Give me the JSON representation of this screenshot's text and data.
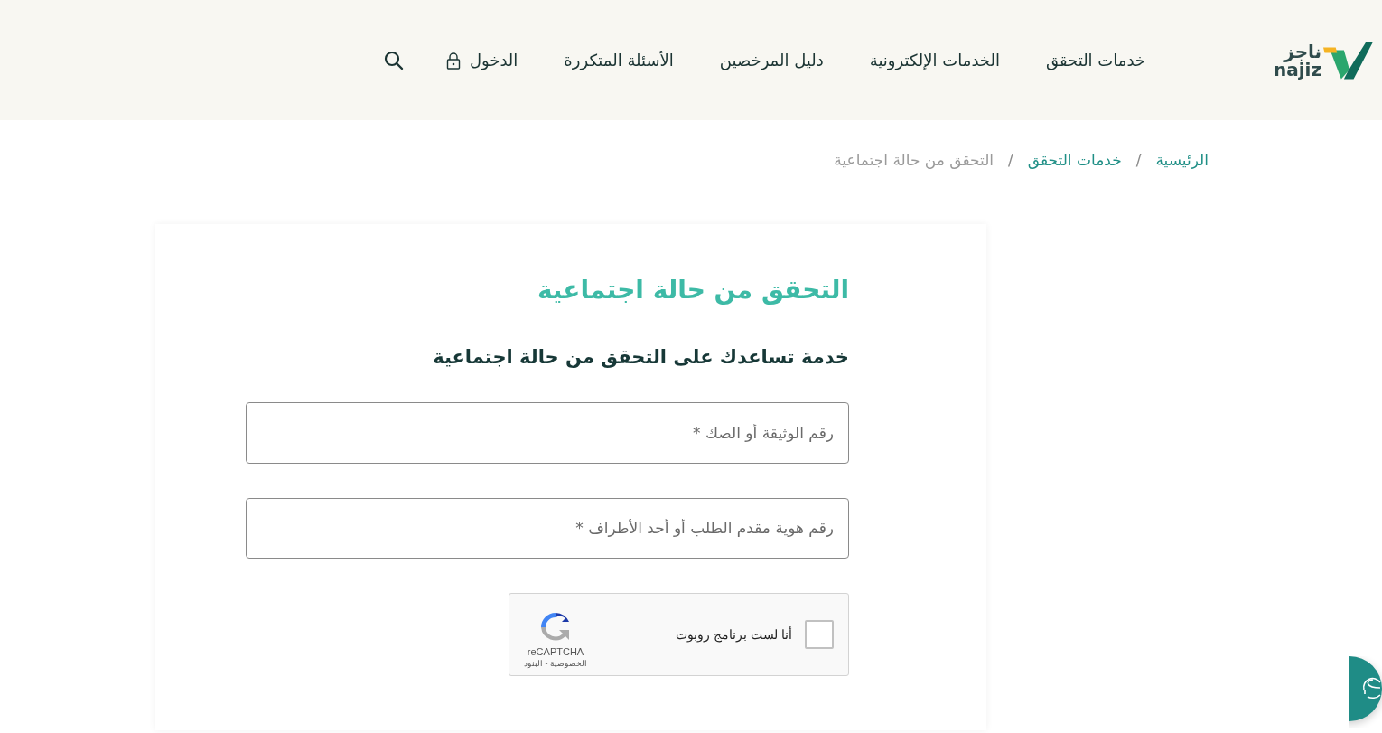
{
  "header": {
    "logo": {
      "arabic": "ناجز",
      "latin": "najiz"
    },
    "nav": [
      {
        "label": "خدمات التحقق",
        "kind": "link"
      },
      {
        "label": "الخدمات الإلكترونية",
        "kind": "link"
      },
      {
        "label": "دليل المرخصين",
        "kind": "link"
      },
      {
        "label": "الأسئلة المتكررة",
        "kind": "link"
      },
      {
        "label": "الدخول",
        "kind": "login"
      }
    ]
  },
  "breadcrumb": [
    {
      "label": "الرئيسية",
      "kind": "link",
      "current": false
    },
    {
      "label": "/",
      "kind": "separator"
    },
    {
      "label": "خدمات التحقق",
      "kind": "link",
      "current": false
    },
    {
      "label": "/",
      "kind": "separator"
    },
    {
      "label": "التحقق من حالة اجتماعية",
      "kind": "link",
      "current": true
    }
  ],
  "form": {
    "title": "التحقق من حالة اجتماعية",
    "subtitle": "خدمة تساعدك على التحقق من حالة اجتماعية",
    "fields": [
      {
        "placeholder": "رقم الوثيقة أو الصك *"
      },
      {
        "placeholder": "رقم هوية مقدم الطلب أو أحد الأطراف *"
      }
    ],
    "captcha": {
      "label": "أنا لست برنامج روبوت",
      "checked": false,
      "brand": "reCAPTCHA",
      "links": "الخصوصية - البنود"
    }
  }
}
